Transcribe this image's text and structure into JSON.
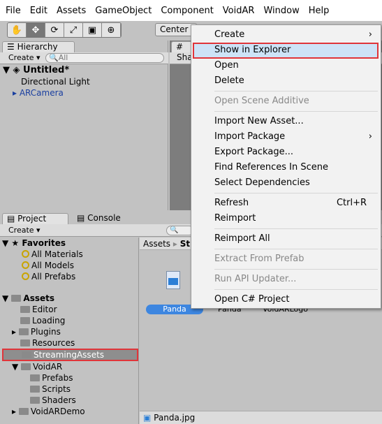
{
  "menubar": [
    "File",
    "Edit",
    "Assets",
    "GameObject",
    "Component",
    "VoidAR",
    "Window",
    "Help"
  ],
  "toolbar": {
    "tools": [
      {
        "icon": "hand-icon",
        "glyph": "✋"
      },
      {
        "icon": "move-icon",
        "glyph": "✥"
      },
      {
        "icon": "rotate-icon",
        "glyph": "⟳"
      },
      {
        "icon": "scale-icon",
        "glyph": "⤢"
      },
      {
        "icon": "rect-icon",
        "glyph": "▣"
      },
      {
        "icon": "transform-icon",
        "glyph": "⊕"
      }
    ],
    "pivot": "Center"
  },
  "hierarchy": {
    "tab": "Hierarchy",
    "create": "Create",
    "search_placeholder": "All",
    "scene": "Untitled*",
    "items": [
      "Directional Light",
      "ARCamera"
    ]
  },
  "scene": {
    "tab": "S",
    "shading": "Sha"
  },
  "project": {
    "tab": "Project",
    "console_tab": "Console",
    "create": "Create",
    "favorites": {
      "label": "Favorites",
      "items": [
        "All Materials",
        "All Models",
        "All Prefabs"
      ]
    },
    "assets": {
      "label": "Assets",
      "items": [
        "Editor",
        "Loading",
        "Plugins",
        "Resources",
        "StreamingAssets",
        "VoidAR",
        "Prefabs",
        "Scripts",
        "Shaders",
        "VoidARDemo"
      ]
    },
    "breadcrumb": [
      "Assets",
      "St"
    ],
    "files": [
      "Panda",
      "Panda",
      "VoidARLogo"
    ],
    "status_file": "Panda.jpg"
  },
  "context_menu": {
    "items": [
      {
        "label": "Create",
        "submenu": true
      },
      {
        "label": "Show in Explorer",
        "highlighted": true
      },
      {
        "label": "Open"
      },
      {
        "label": "Delete"
      },
      {
        "label": "Open Scene Additive",
        "disabled": true
      },
      {
        "label": "Import New Asset..."
      },
      {
        "label": "Import Package",
        "submenu": true
      },
      {
        "label": "Export Package..."
      },
      {
        "label": "Find References In Scene"
      },
      {
        "label": "Select Dependencies"
      },
      {
        "label": "Refresh",
        "shortcut": "Ctrl+R"
      },
      {
        "label": "Reimport"
      },
      {
        "label": "Reimport All"
      },
      {
        "label": "Extract From Prefab",
        "disabled": true
      },
      {
        "label": "Run API Updater...",
        "disabled": true
      },
      {
        "label": "Open C# Project"
      }
    ]
  },
  "colors": {
    "highlight_border": "#e0353a",
    "selection": "#3d86e0",
    "link_blue": "#1a3fa0"
  }
}
